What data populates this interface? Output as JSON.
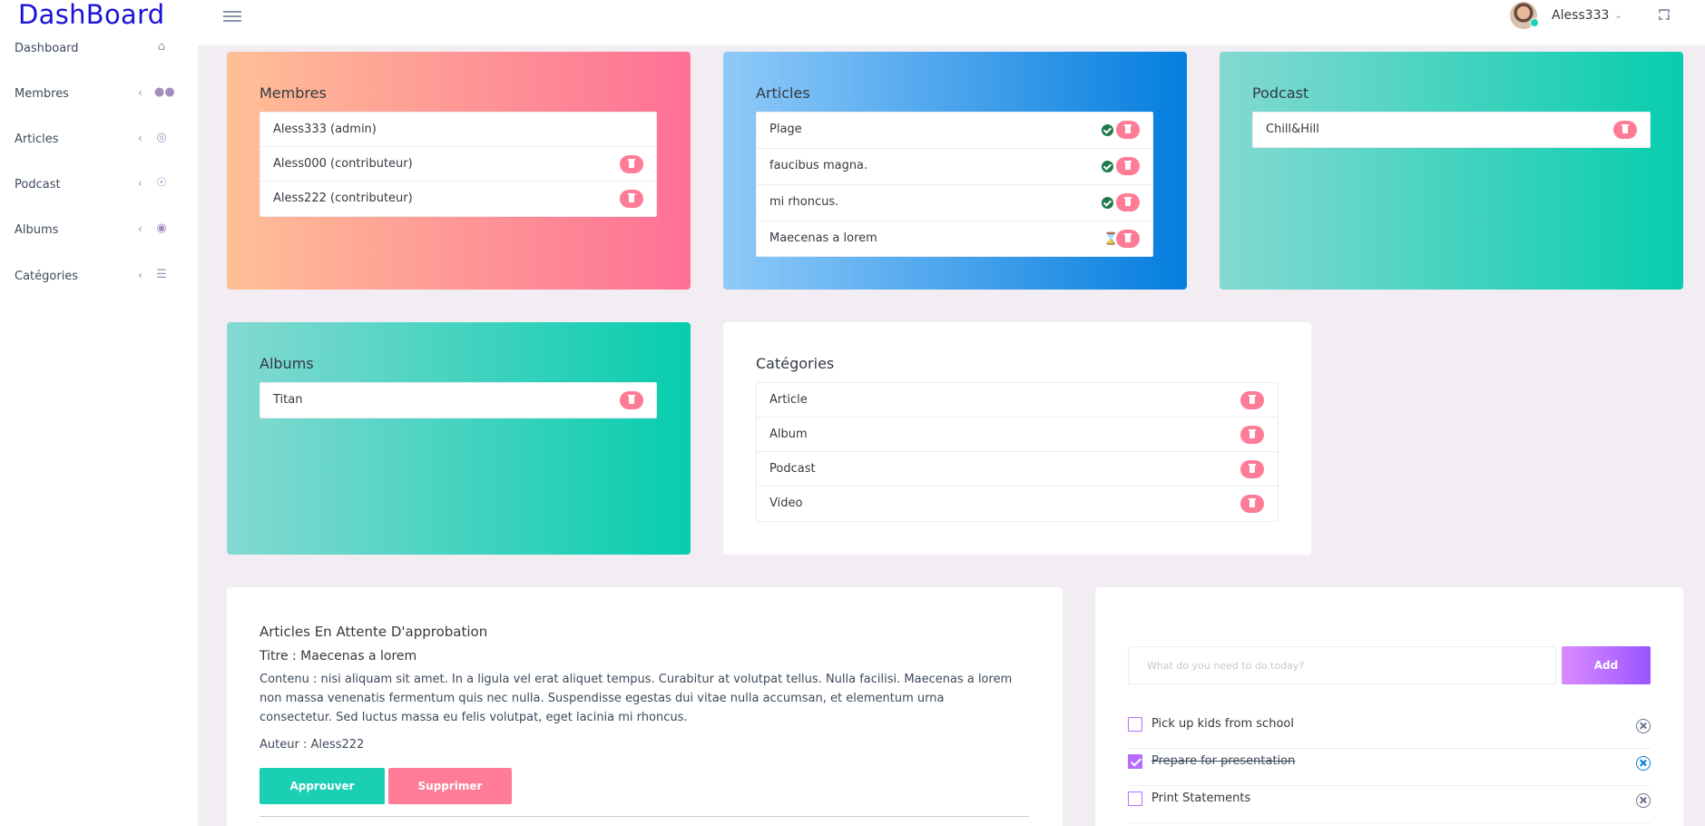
{
  "header": {
    "brand": "DashBoard",
    "user_name": "Aless333"
  },
  "sidebar": {
    "items": [
      {
        "label": "Dashboard",
        "icon": "home-icon",
        "has_arrow": false
      },
      {
        "label": "Membres",
        "icon": "users-icon",
        "has_arrow": true
      },
      {
        "label": "Articles",
        "icon": "target-icon",
        "has_arrow": true
      },
      {
        "label": "Podcast",
        "icon": "podcast-icon",
        "has_arrow": true
      },
      {
        "label": "Albums",
        "icon": "disc-icon",
        "has_arrow": true
      },
      {
        "label": "Catégories",
        "icon": "list-icon",
        "has_arrow": true
      }
    ]
  },
  "cards": {
    "membres": {
      "title": "Membres",
      "items": [
        "Aless333 (admin)",
        "Aless000 (contributeur)",
        "Aless222 (contributeur)"
      ]
    },
    "articles": {
      "title": "Articles",
      "items": [
        {
          "label": "Plage",
          "status": "approved"
        },
        {
          "label": "faucibus magna.",
          "status": "approved"
        },
        {
          "label": "mi rhoncus.",
          "status": "approved"
        },
        {
          "label": "Maecenas a lorem",
          "status": "pending"
        }
      ]
    },
    "podcast": {
      "title": "Podcast",
      "items": [
        "Chill&Hill"
      ]
    },
    "albums": {
      "title": "Albums",
      "items": [
        "Titan"
      ]
    },
    "categories": {
      "title": "Catégories",
      "items": [
        "Article",
        "Album",
        "Podcast",
        "Video"
      ]
    }
  },
  "approval": {
    "title": "Articles En Attente D'approbation",
    "titre": "Titre : Maecenas a lorem",
    "content": "Contenu : nisi aliquam sit amet. In a ligula vel erat aliquet tempus. Curabitur at volutpat tellus. Nulla facilisi. Maecenas a lorem non massa venenatis fermentum quis nec nulla. Suspendisse egestas dui vitae nulla accumsan, et elementum urna consectetur. Sed luctus massa eu felis volutpat, eget lacinia mi rhoncus.",
    "author": "Auteur : Aless222",
    "approve_label": "Approuver",
    "delete_label": "Supprimer"
  },
  "todo": {
    "placeholder": "What do you need to do today?",
    "add_label": "Add",
    "items": [
      {
        "label": "Pick up kids from school",
        "done": false
      },
      {
        "label": "Prepare for presentation",
        "done": true
      },
      {
        "label": "Print Statements",
        "done": false
      }
    ]
  }
}
